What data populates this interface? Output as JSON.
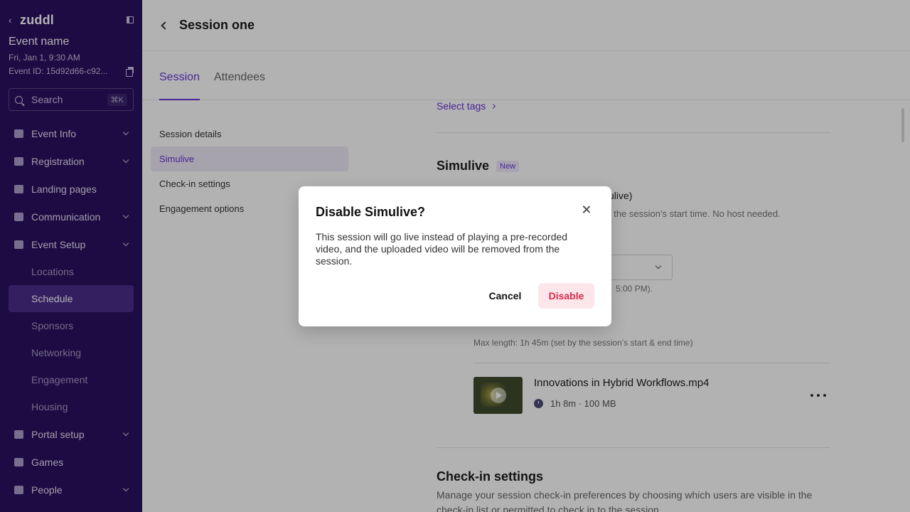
{
  "sidebar": {
    "brand": "zuddl",
    "event_name": "Event name",
    "event_date": "Fri, Jan 1, 9:30 AM",
    "event_id": "Event ID: 15d92d66-c92...",
    "search": {
      "placeholder": "Search",
      "shortcut": "⌘K"
    },
    "nav": [
      {
        "label": "Event Info",
        "has_chevron": true
      },
      {
        "label": "Registration",
        "has_chevron": true
      },
      {
        "label": "Landing pages",
        "has_chevron": false
      },
      {
        "label": "Communication",
        "has_chevron": true
      },
      {
        "label": "Event Setup",
        "has_chevron": true,
        "expanded": true
      }
    ],
    "event_setup_items": [
      "Locations",
      "Schedule",
      "Sponsors",
      "Networking",
      "Engagement",
      "Housing"
    ],
    "active_sub_item": "Schedule",
    "nav_bottom": [
      {
        "label": "Portal setup",
        "has_chevron": true
      },
      {
        "label": "Games",
        "has_chevron": false
      },
      {
        "label": "People",
        "has_chevron": true
      }
    ]
  },
  "header": {
    "title": "Session one"
  },
  "tabs": [
    {
      "label": "Session",
      "active": true
    },
    {
      "label": "Attendees",
      "active": false
    }
  ],
  "subnav": [
    {
      "label": "Session details",
      "active": false
    },
    {
      "label": "Simulive",
      "active": true
    },
    {
      "label": "Check-in settings",
      "active": false
    },
    {
      "label": "Engagement options",
      "active": false
    }
  ],
  "content": {
    "select_tags": "Select tags",
    "simulive_title": "Simulive",
    "new_badge": "New",
    "option_label_partial": "ulive)",
    "option_desc_partial": "t the session's start time. No host needed.",
    "dropdown_hint_partial": "5:00 PM).",
    "max_length": "Max length: 1h 45m (set by the session’s start & end time)",
    "file": {
      "name": "Innovations in Hybrid Workflows.mp4",
      "meta": "1h 8m · 100 MB"
    },
    "checkin": {
      "title": "Check-in settings",
      "desc": "Manage your session check-in preferences by choosing which users are visible in the check-in list or permitted to check in to the session."
    }
  },
  "modal": {
    "title": "Disable Simulive?",
    "body": "This session will go live instead of playing a pre-recorded video, and the uploaded video will be removed from the session.",
    "cancel_label": "Cancel",
    "confirm_label": "Disable"
  },
  "colors": {
    "sidebar_bg": "#2a1060",
    "accent": "#6a35d8",
    "danger": "#d92a4b",
    "danger_bg": "#fde6ea"
  }
}
